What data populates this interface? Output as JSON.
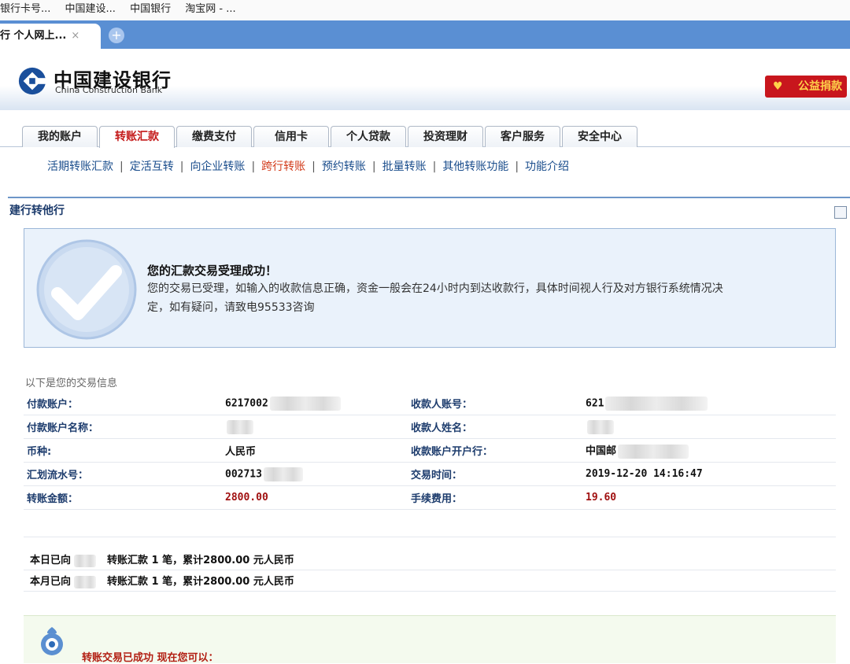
{
  "browser": {
    "bookmarks": [
      "银行卡号...",
      "中国建设...",
      "中国银行",
      "淘宝网 - ..."
    ],
    "tab_title": "行 个人网上...",
    "tab_close": "×",
    "new_tab": "+"
  },
  "header": {
    "brand_cn": "中国建设银行",
    "brand_en": "China Construction Bank",
    "donate_label": "公益捐款",
    "brand_color": "#1a4f9c",
    "accent_color": "#c8161d"
  },
  "nav": {
    "tabs": [
      "我的账户",
      "转账汇款",
      "缴费支付",
      "信用卡",
      "个人贷款",
      "投资理财",
      "客户服务",
      "安全中心"
    ],
    "active_tab": "转账汇款"
  },
  "subnav": {
    "items": [
      "活期转账汇款",
      "定活互转",
      "向企业转账",
      "跨行转账",
      "预约转账",
      "批量转账",
      "其他转账功能",
      "功能介绍"
    ],
    "active_item": "跨行转账",
    "separator": "|"
  },
  "section": {
    "title": "建行转他行"
  },
  "success": {
    "title": "您的汇款交易受理成功！",
    "line1": "您的交易已受理，如输入的收款信息正确，资金一般会在24小时内到达收款行，具体时间视人行及对方银行系统情况决",
    "line2": "定，如有疑问，请致电95533咨询"
  },
  "details": {
    "caption": "以下是您的交易信息",
    "rows": [
      {
        "l1": "付款账户：",
        "v1": "6217002",
        "l2": "收款人账号：",
        "v2": "621"
      },
      {
        "l1": "付款账户名称：",
        "v1": "",
        "l2": "收款人姓名：",
        "v2": ""
      },
      {
        "l1": "币种:",
        "v1": "人民币",
        "l2": "收款账户开户行：",
        "v2": "中国邮"
      },
      {
        "l1": "汇划流水号：",
        "v1": "002713",
        "l2": "交易时间：",
        "v2": "2019-12-20 14:16:47"
      },
      {
        "l1": "转账金额：",
        "v1": "2800.00",
        "l2": "手续费用：",
        "v2": "19.60"
      }
    ]
  },
  "summary": {
    "today_prefix": "本日已向",
    "month_prefix": "本月已向",
    "text": "转账汇款 1 笔，累计2800.00 元人民币"
  },
  "footer": {
    "text": "转账交易已成功 现在您可以："
  }
}
